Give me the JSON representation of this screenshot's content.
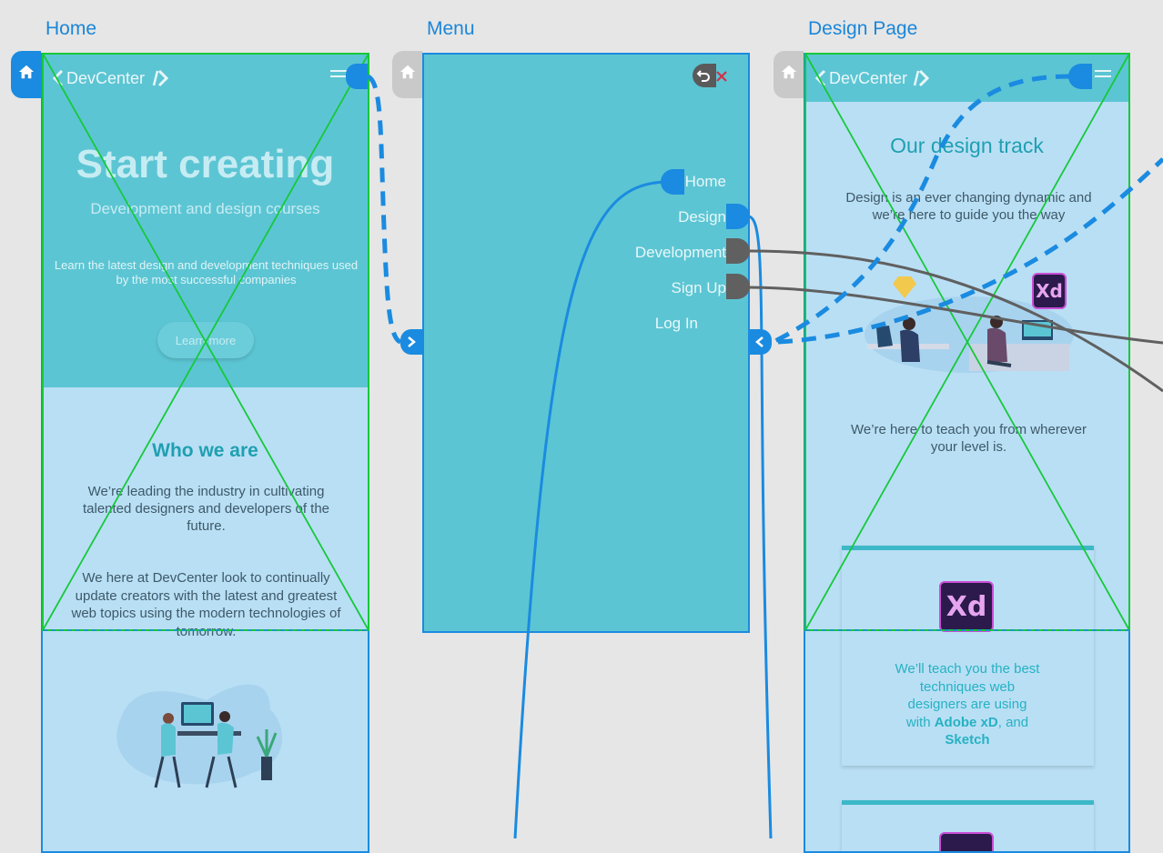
{
  "artboards": {
    "home_label": "Home",
    "menu_label": "Menu",
    "design_label": "Design Page"
  },
  "home": {
    "logo": "DevCenter",
    "hero_title": "Start creating",
    "hero_subtitle": "Development and design courses",
    "hero_text": "Learn the latest design and development techniques used by the most successful companies",
    "cta_label": "Learn more",
    "who_title": "Who we are",
    "who_text1": "We’re leading the industry in cultivating talented designers and developers of the future.",
    "who_text2": "We here at DevCenter look to continually update creators with the latest and greatest web topics using the modern technologies of tomorrow."
  },
  "menu": {
    "items": [
      "Home",
      "Design",
      "Development",
      "Sign Up",
      "Log In"
    ]
  },
  "design": {
    "logo": "DevCenter",
    "title": "Our design track",
    "intro": "Design is an ever changing dynamic and we’re here to guide you the way",
    "teach": "We’re here to teach you from wherever your level is.",
    "xd_badge": "Xd",
    "card_text_prefix": "We’ll teach you the best techniques web designers are using with ",
    "card_bold1": "Adobe xD",
    "card_mid": ", and ",
    "card_bold2": "Sketch"
  },
  "colors": {
    "accent": "#1a8be0",
    "hero": "#5cc5d3",
    "panel": "#b9dff5",
    "crossout": "#16c93a",
    "canvas": "#e6e6e6"
  }
}
